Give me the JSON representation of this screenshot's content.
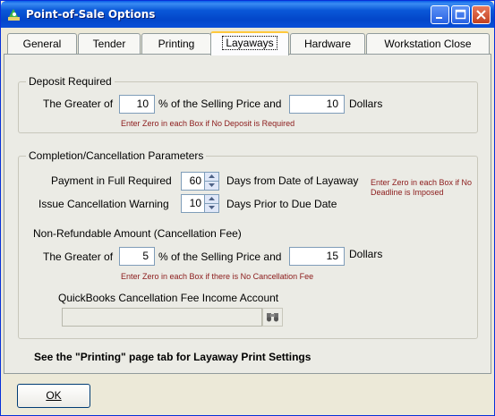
{
  "window": {
    "title": "Point-of-Sale Options"
  },
  "title_buttons": {
    "minimize": "_",
    "maximize": "□",
    "close": "✕"
  },
  "tabs": [
    {
      "label": "General"
    },
    {
      "label": "Tender"
    },
    {
      "label": "Printing"
    },
    {
      "label": "Layaways",
      "active": true
    },
    {
      "label": "Hardware"
    },
    {
      "label": "Workstation Close"
    }
  ],
  "deposit": {
    "title": "Deposit Required",
    "greater_of": "The Greater of",
    "percent_value": "10",
    "percent_label": "% of the Selling Price and",
    "dollar_value": "10",
    "dollars_label": "Dollars",
    "note": "Enter Zero in each Box if No Deposit is Required"
  },
  "completion": {
    "title": "Completion/Cancellation Parameters",
    "payment_label": "Payment in Full Required",
    "payment_days": "60",
    "payment_suffix": "Days from Date of Layaway",
    "warning_label": "Issue Cancellation Warning",
    "warning_days": "10",
    "warning_suffix": "Days Prior to Due Date",
    "deadline_note": "Enter Zero in each Box if No Deadline is Imposed",
    "fee_heading": "Non-Refundable Amount (Cancellation Fee)",
    "greater_of": "The Greater of",
    "fee_percent": "5",
    "percent_label": "% of the Selling Price and",
    "fee_dollars": "15",
    "dollars_label": "Dollars",
    "fee_note": "Enter Zero in each Box if there is No Cancellation Fee",
    "account_label": "QuickBooks Cancellation Fee Income Account",
    "account_value": ""
  },
  "printing_note": "See the \"Printing\" page tab for Layaway Print Settings",
  "ok_label": "OK",
  "colors": {
    "title_bar": "#0a58d8",
    "note_text": "#8b1a1a",
    "active_tab_highlight": "#ffc83c"
  }
}
